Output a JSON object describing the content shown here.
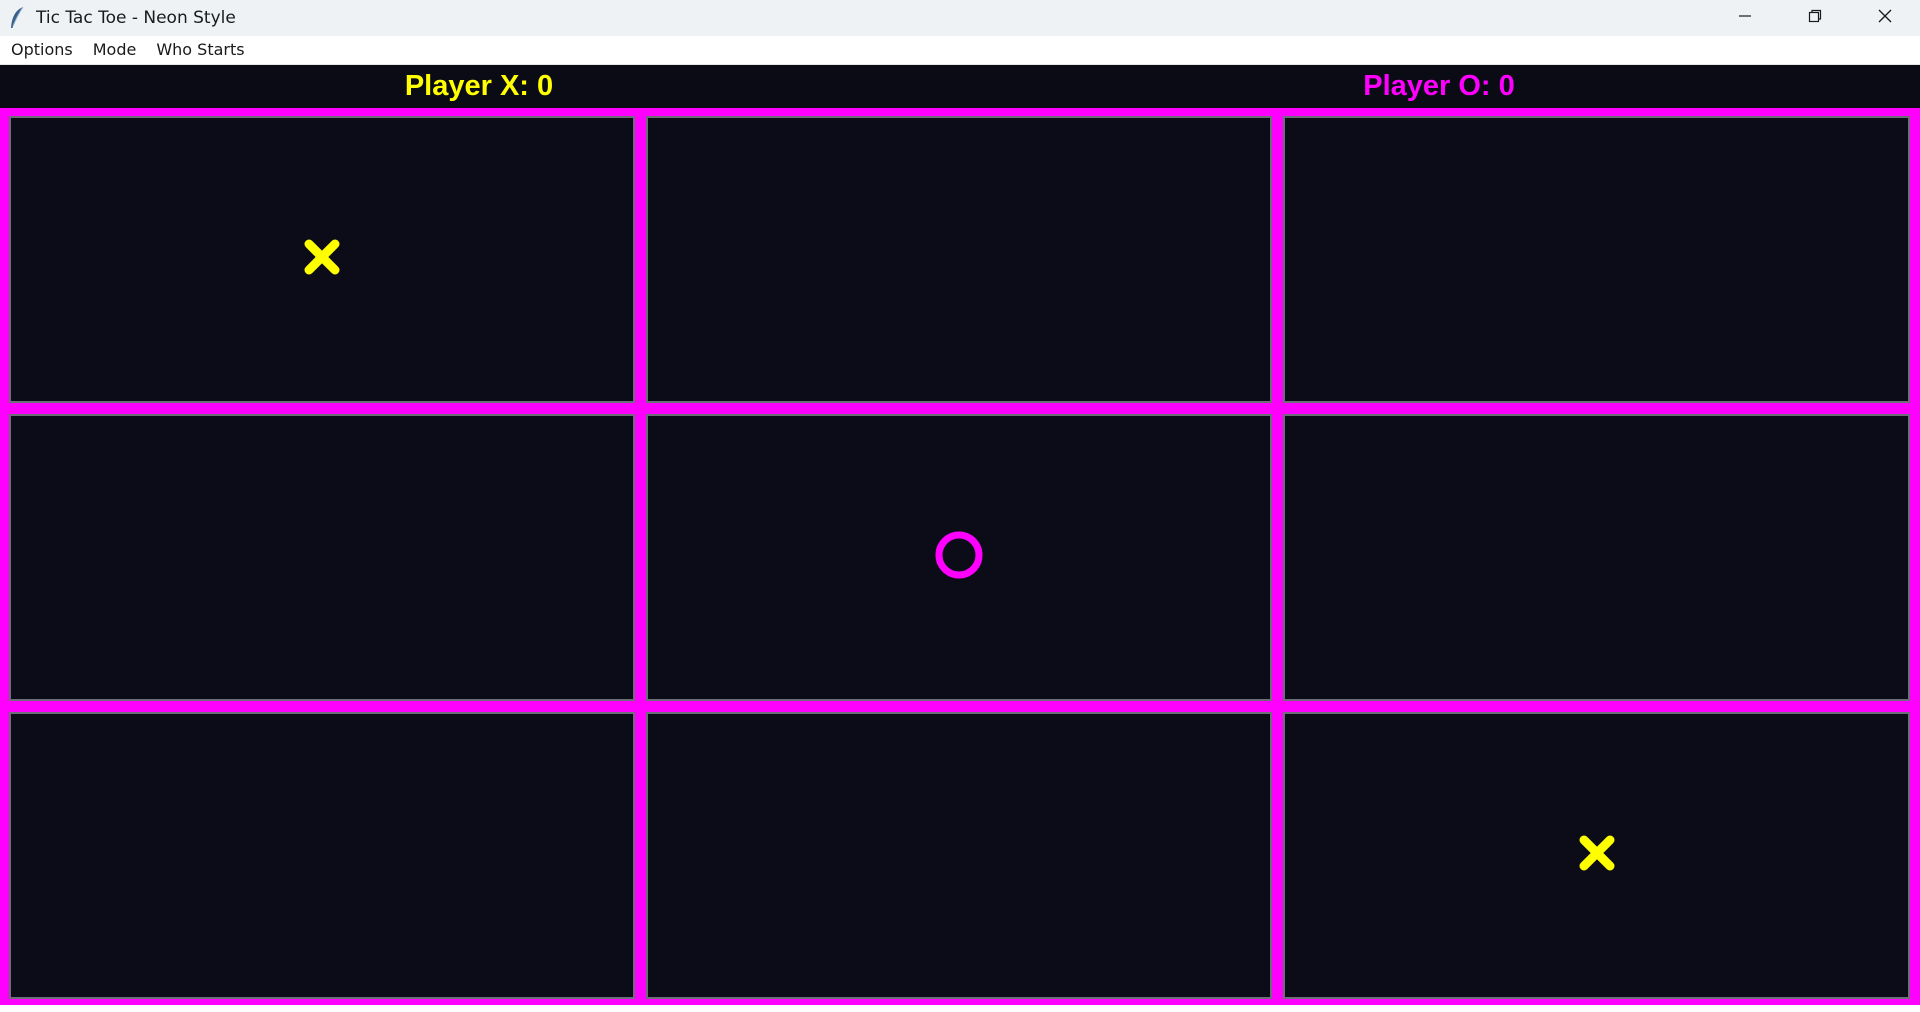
{
  "window": {
    "title": "Tic Tac Toe - Neon Style",
    "controls": [
      "minimize-icon",
      "restore-icon",
      "close-icon"
    ]
  },
  "menu": {
    "items": [
      {
        "label": "Options"
      },
      {
        "label": "Mode"
      },
      {
        "label": "Who Starts"
      }
    ]
  },
  "score": {
    "x_label": "Player X: 0",
    "o_label": "Player O: 0"
  },
  "colors": {
    "x": "#ffff00",
    "o": "#ff00ff",
    "grid": "#ff00ff",
    "background": "#0b0b16"
  },
  "board": {
    "cells": [
      "X",
      "",
      "",
      "",
      "O",
      "",
      "",
      "",
      "X"
    ]
  }
}
